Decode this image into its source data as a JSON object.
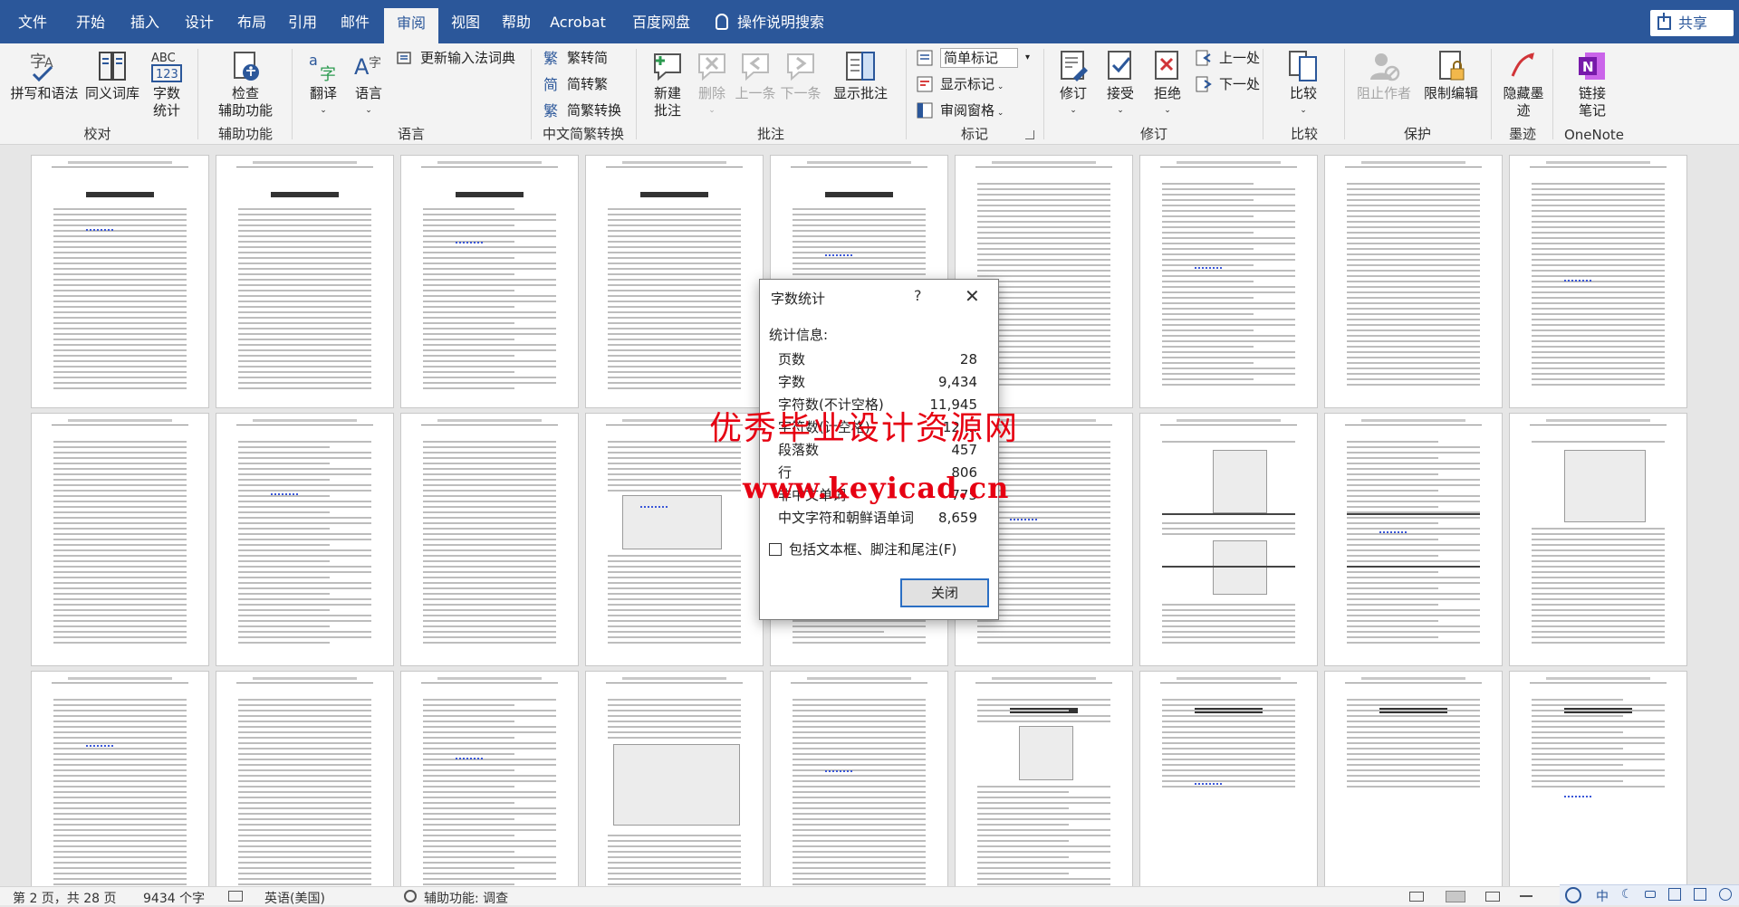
{
  "tabs": [
    {
      "label": "文件",
      "active": false
    },
    {
      "label": "开始",
      "active": false
    },
    {
      "label": "插入",
      "active": false
    },
    {
      "label": "设计",
      "active": false
    },
    {
      "label": "布局",
      "active": false
    },
    {
      "label": "引用",
      "active": false
    },
    {
      "label": "邮件",
      "active": false
    },
    {
      "label": "审阅",
      "active": true
    },
    {
      "label": "视图",
      "active": false
    },
    {
      "label": "帮助",
      "active": false
    },
    {
      "label": "Acrobat",
      "active": false
    },
    {
      "label": "百度网盘",
      "active": false
    }
  ],
  "tell_me": "操作说明搜索",
  "share_label": "共享",
  "ribbon": {
    "proofing": {
      "label": "校对",
      "spelling": "拼写和语法",
      "thesaurus": "同义词库",
      "word_count_line1": "字数",
      "word_count_line2": "统计"
    },
    "accessibility": {
      "label": "辅助功能",
      "check_line1": "检查",
      "check_line2": "辅助功能"
    },
    "language": {
      "label": "语言",
      "translate": "翻译",
      "language": "语言",
      "update_ime": "更新输入法词典"
    },
    "chinese_conversion": {
      "label": "中文简繁转换",
      "to_traditional": "繁转简",
      "to_simplified": "简转繁",
      "conversion": "简繁转换"
    },
    "comments": {
      "label": "批注",
      "new_line1": "新建",
      "new_line2": "批注",
      "delete": "删除",
      "previous": "上一条",
      "next": "下一条",
      "show": "显示批注"
    },
    "tracking": {
      "label": "标记",
      "simple_markup": "简单标记",
      "show_markup": "显示标记",
      "reviewing_pane": "审阅窗格"
    },
    "changes": {
      "label": "修订",
      "track": "修订",
      "accept": "接受",
      "reject": "拒绝",
      "previous": "上一处",
      "next": "下一处"
    },
    "compare": {
      "label": "比较",
      "compare": "比较"
    },
    "protect": {
      "label": "保护",
      "block_authors": "阻止作者",
      "restrict_editing": "限制编辑"
    },
    "ink": {
      "label": "墨迹",
      "hide_ink_line1": "隐藏墨",
      "hide_ink_line2": "迹"
    },
    "onenote": {
      "label": "OneNote",
      "linked_line1": "链接",
      "linked_line2": "笔记"
    }
  },
  "dialog": {
    "title": "字数统计",
    "help": "?",
    "close_x": "✕",
    "stats_header": "统计信息:",
    "stats": [
      {
        "label": "页数",
        "value": "28"
      },
      {
        "label": "字数",
        "value": "9,434"
      },
      {
        "label": "字符数(不计空格)",
        "value": "11,945"
      },
      {
        "label": "字符数(计空格)",
        "value": "12,..."
      },
      {
        "label": "段落数",
        "value": "457"
      },
      {
        "label": "行",
        "value": "806"
      },
      {
        "label": "非中文单词",
        "value": "775"
      },
      {
        "label": "中文字符和朝鲜语单词",
        "value": "8,659"
      }
    ],
    "checkbox_label": "包括文本框、脚注和尾注(F)",
    "checkbox_checked": false,
    "close_button": "关闭"
  },
  "watermark": {
    "line1": "优秀毕业设计资源网",
    "line2": "www.keyicad.cn"
  },
  "status": {
    "page": "第 2 页，共 28 页",
    "words": "9434 个字",
    "language": "英语(美国)",
    "accessibility": "辅助功能: 调查"
  },
  "tray": {
    "lang": "中",
    "moon": "☾"
  }
}
